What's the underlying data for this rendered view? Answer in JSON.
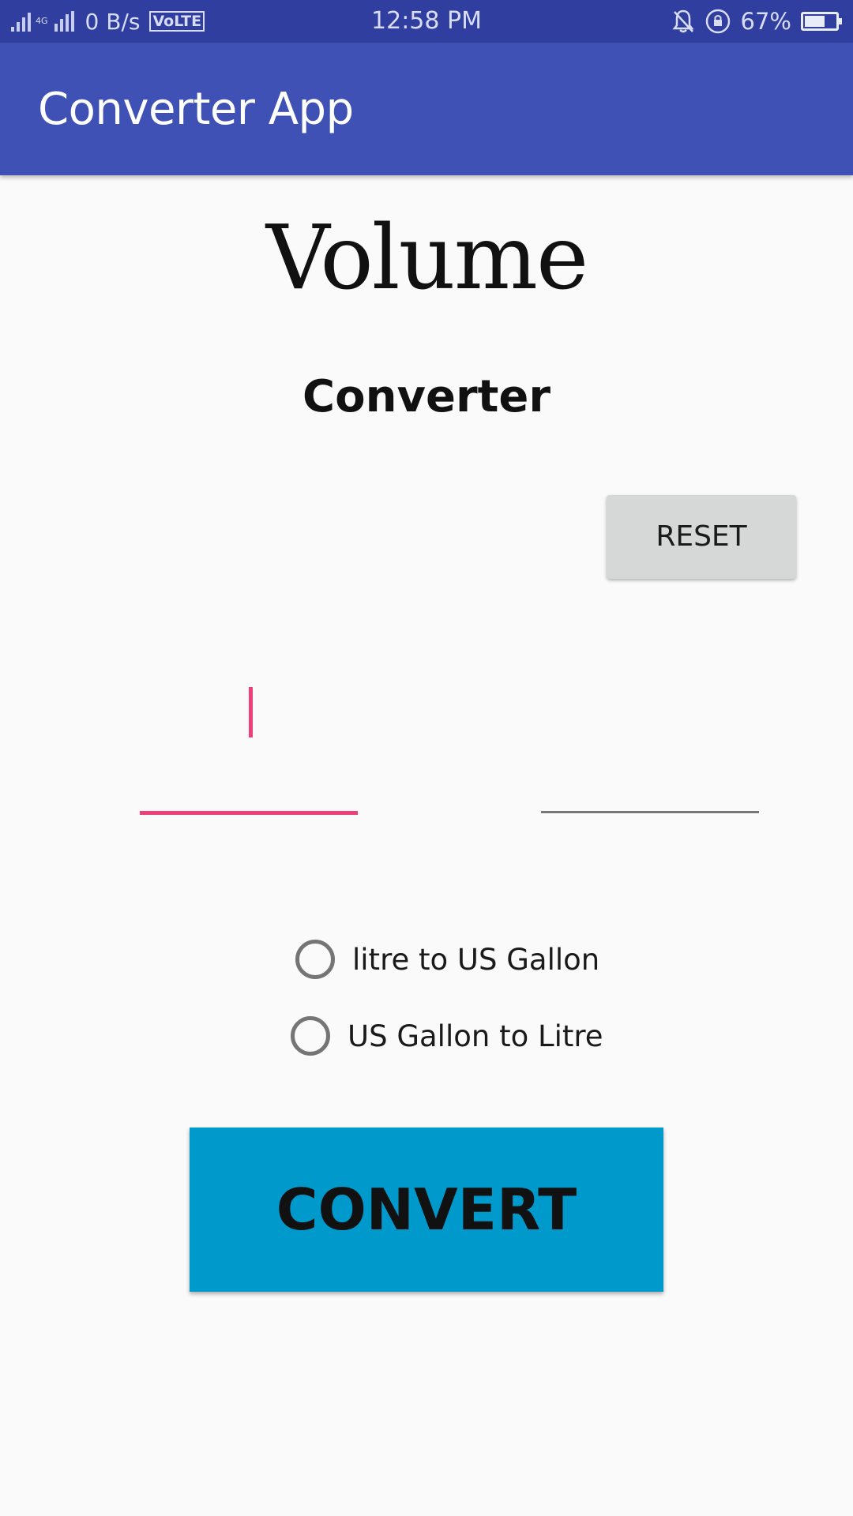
{
  "status_bar": {
    "network_type": "4G",
    "data_speed": "0 B/s",
    "volte": "VoLTE",
    "time": "12:58 PM",
    "battery": "67%",
    "battery_level": 0.67,
    "icons": [
      "signal-icon",
      "signal-4g-icon",
      "bell-off-icon",
      "rotation-lock-icon",
      "battery-icon"
    ]
  },
  "app_bar": {
    "title": "Converter App",
    "color": "#3f51b5"
  },
  "main": {
    "heading": "Volume",
    "subheading": "Converter",
    "reset_label": "RESET",
    "input_value": "",
    "output_value": "",
    "radios": [
      {
        "label": "litre to US Gallon",
        "checked": false
      },
      {
        "label": "US Gallon to Litre",
        "checked": false
      }
    ],
    "convert_label": "CONVERT",
    "accent_color": "#ec407a",
    "convert_color": "#0099cc"
  }
}
